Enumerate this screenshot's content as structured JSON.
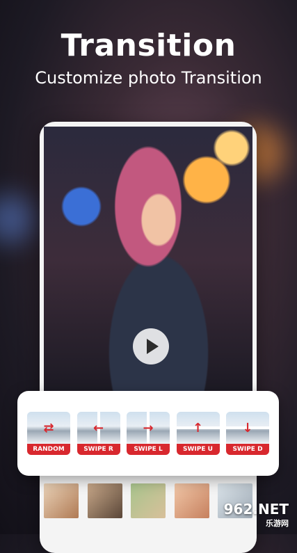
{
  "header": {
    "title": "Transition",
    "subtitle": "Customize photo Transition"
  },
  "transitions": [
    {
      "label": "RANDOM",
      "arrow": "⇄"
    },
    {
      "label": "SWIPE R",
      "arrow": "←"
    },
    {
      "label": "SWIPE L",
      "arrow": "→"
    },
    {
      "label": "SWIPE U",
      "arrow": "↑"
    },
    {
      "label": "SWIPE D",
      "arrow": "↓"
    }
  ],
  "colors": {
    "accent": "#d8282e",
    "panel": "#ffffff"
  },
  "icons": {
    "play": "play-icon"
  },
  "watermark": {
    "text": "962.NET",
    "sub": "乐游网"
  }
}
